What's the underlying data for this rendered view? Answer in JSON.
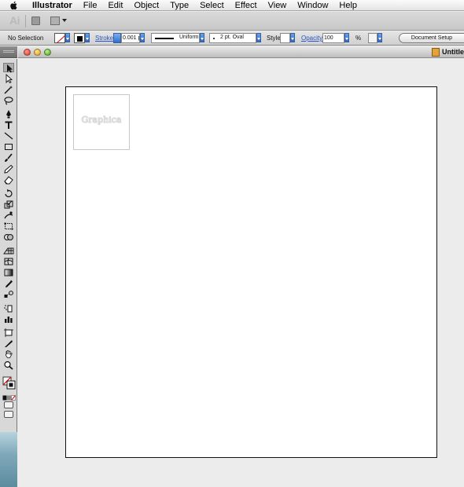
{
  "menubar": {
    "app_name": "Illustrator",
    "items": [
      "File",
      "Edit",
      "Object",
      "Type",
      "Select",
      "Effect",
      "View",
      "Window",
      "Help"
    ]
  },
  "appbar": {
    "logo": "Ai"
  },
  "control": {
    "selection_label": "No Selection",
    "stroke_label": "Stroke",
    "stroke_weight": "0.001 pt",
    "profile_label": "Uniform",
    "brush_label": "2 pt. Oval",
    "style_label": "Style:",
    "opacity_label": "Opacity",
    "opacity_value": "100",
    "percent_sign": "%",
    "document_setup": "Document Setup"
  },
  "document": {
    "title": "Untitled",
    "thumbnail_text": "Graphica"
  },
  "colors": {
    "accent": "#2d6cc6",
    "fill_none_slash": "#dd0000",
    "artboard": "#ffffff",
    "canvas": "#ececec"
  },
  "tools": [
    "selection-tool",
    "direct-selection-tool",
    "magic-wand-tool",
    "lasso-tool",
    "pen-tool",
    "type-tool",
    "line-segment-tool",
    "rectangle-tool",
    "paintbrush-tool",
    "pencil-tool",
    "eraser-tool",
    "rotate-tool",
    "scale-tool",
    "warp-tool",
    "free-transform-tool",
    "shape-builder-tool",
    "perspective-grid-tool",
    "mesh-tool",
    "gradient-tool",
    "eyedropper-tool",
    "blend-tool",
    "symbol-sprayer-tool",
    "column-graph-tool",
    "artboard-tool",
    "slice-tool",
    "hand-tool",
    "zoom-tool"
  ]
}
